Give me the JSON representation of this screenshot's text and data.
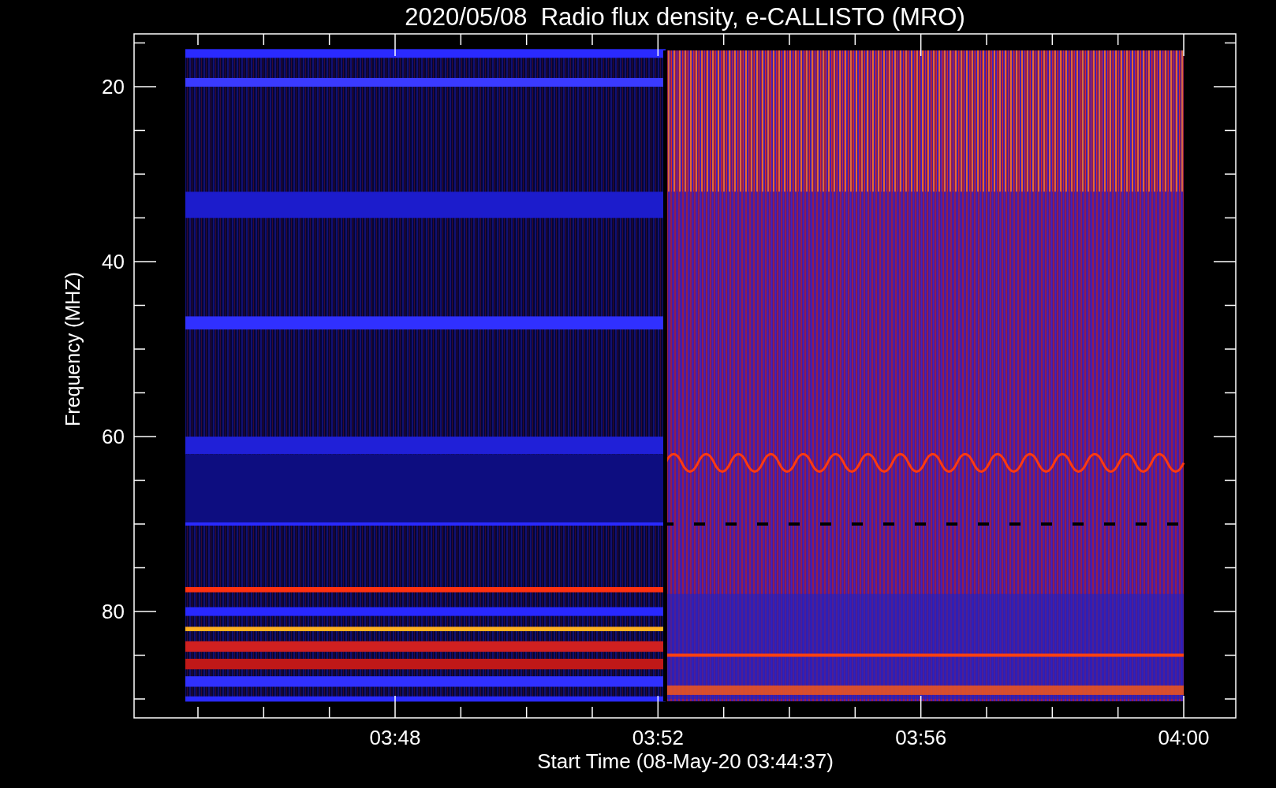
{
  "title": "2020/05/08  Radio flux density, e-CALLISTO (MRO)",
  "y_axis": {
    "label": "Frequency (MHZ)",
    "ticks": [
      "20",
      "40",
      "60",
      "80"
    ]
  },
  "x_axis": {
    "label": "Start Time (08-May-20 03:44:37)",
    "ticks": [
      "03:48",
      "03:52",
      "03:56",
      "04:00"
    ]
  }
}
